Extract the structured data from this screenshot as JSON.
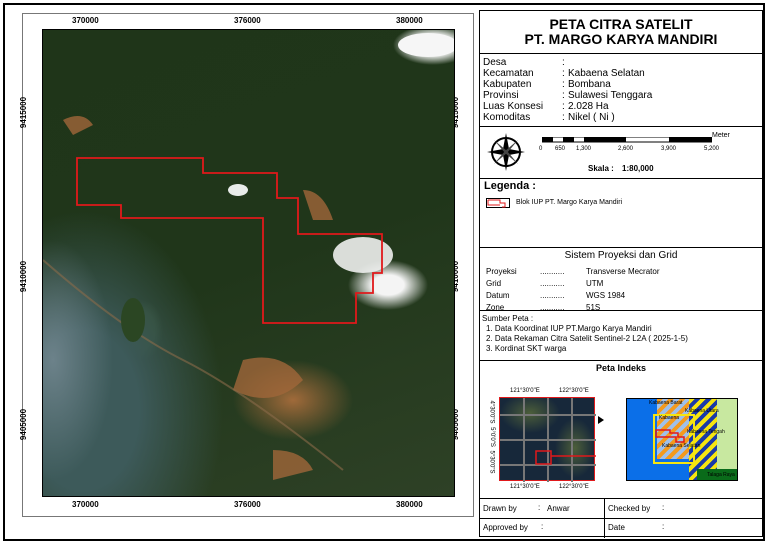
{
  "map": {
    "x_ticks": [
      "370000",
      "376000",
      "380000"
    ],
    "y_ticks": [
      "9415000",
      "9410000",
      "9405000"
    ],
    "boundary_color": "#e0191b"
  },
  "title": {
    "line1": "PETA  CITRA SATELIT",
    "line2": "PT. MARGO KARYA MANDIRI"
  },
  "info": [
    {
      "label": "Desa",
      "value": ""
    },
    {
      "label": "Kecamatan",
      "value": "Kabaena Selatan"
    },
    {
      "label": "Kabupaten",
      "value": "Bombana"
    },
    {
      "label": "Provinsi",
      "value": "Sulawesi Tenggara"
    },
    {
      "label": "Luas Konsesi",
      "value": "2.028 Ha"
    },
    {
      "label": "Komoditas",
      "value": "Nikel ( Ni )"
    }
  ],
  "scale": {
    "unit": "Meter",
    "ticks": [
      "0",
      "650",
      "1,300",
      "2,600",
      "3,900",
      "5,200"
    ],
    "label": "Skala :",
    "value": "1:80,000"
  },
  "legend": {
    "title": "Legenda :",
    "items": [
      {
        "label": "Blok IUP PT. Margo Karya Mandiri"
      }
    ]
  },
  "projection": {
    "title": "Sistem Proyeksi dan Grid",
    "rows": [
      {
        "label": "Proyeksi",
        "dots": "...........",
        "value": "Transverse Mecrator"
      },
      {
        "label": "Grid",
        "dots": "...........",
        "value": "UTM"
      },
      {
        "label": "Datum",
        "dots": "...........",
        "value": "WGS 1984"
      },
      {
        "label": "Zone",
        "dots": "...........",
        "value": "51S"
      }
    ]
  },
  "sources": {
    "title": "Sumber Peta :",
    "items": [
      "1. Data Koordinat IUP PT.Margo Karya Mandiri",
      "2. Data Rekaman Citra Satelit Sentinel-2 L2A ( 2025-1-5)",
      "3. Kordinat SKT warga"
    ]
  },
  "index": {
    "title": "Peta Indeks",
    "lon": [
      "121°30'0\"E",
      "122°30'0\"E"
    ],
    "lat": [
      "4°30'0\"S",
      "5°0'0\"S",
      "5°30'0\"S"
    ],
    "places": [
      "Kabaena Barat",
      "Kabaena Utara",
      "Kabaena",
      "Kabaena Tengah",
      "Kabaena Selatan",
      "Talaga Raya"
    ]
  },
  "footer": {
    "drawn_label": "Drawn by",
    "drawn_value": "Anwar",
    "checked_label": "Checked  by",
    "approved_label": "Approved  by",
    "date_label": "Date",
    "colon": ":"
  }
}
